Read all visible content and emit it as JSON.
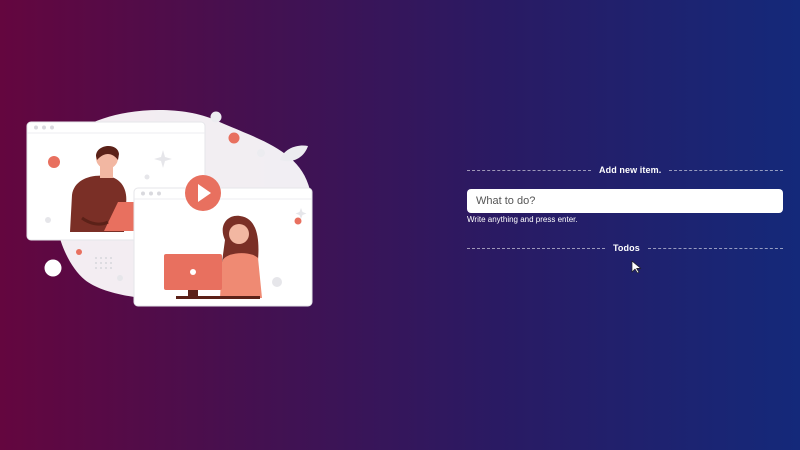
{
  "add_section": {
    "title": "Add new item.",
    "input_placeholder": "What to do?",
    "input_value": "",
    "hint": "Write anything and press enter."
  },
  "todos_section": {
    "title": "Todos",
    "items": []
  },
  "illustration": {
    "description_icon": "video-call-illustration",
    "accent_color": "#e8705f"
  },
  "colors": {
    "background_left": "#64063f",
    "background_right": "#14297a",
    "accent": "#e8705f"
  }
}
